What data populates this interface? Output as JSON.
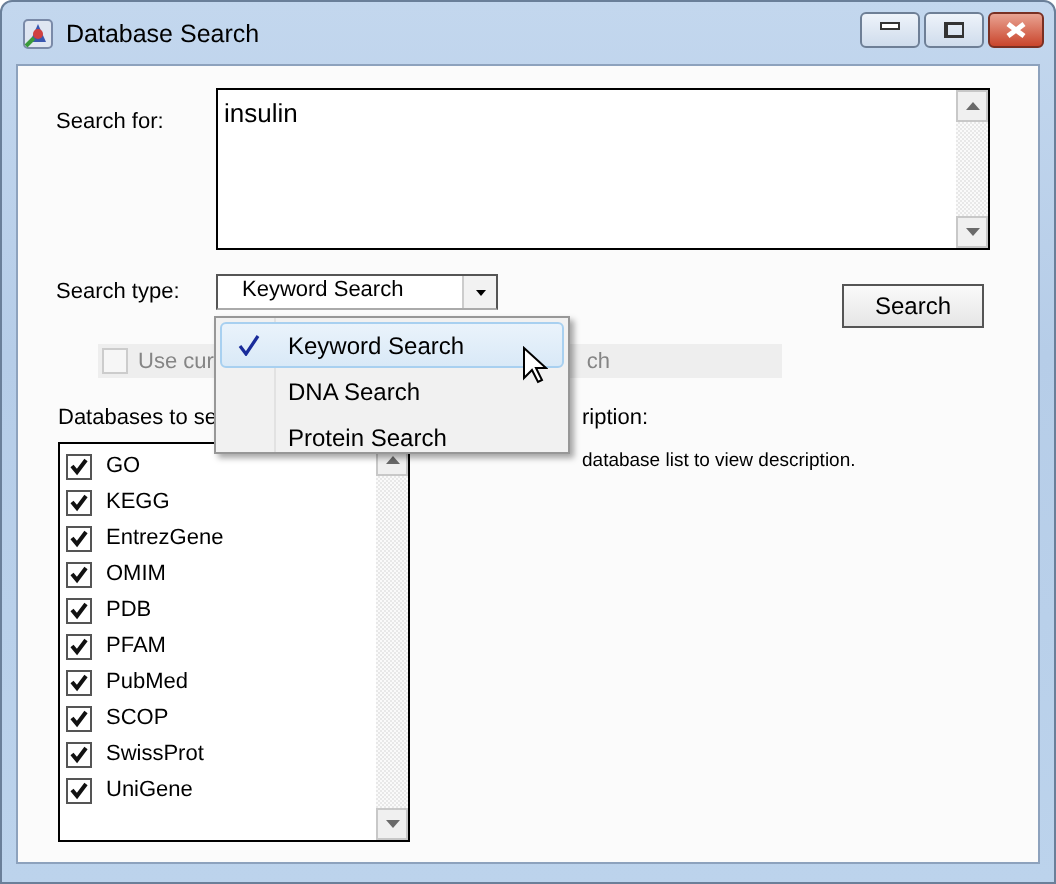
{
  "window": {
    "title": "Database Search"
  },
  "search_for": {
    "label": "Search for:",
    "value": "insulin"
  },
  "search_type": {
    "label": "Search type:",
    "value": "Keyword Search"
  },
  "search_button": {
    "label": "Search"
  },
  "use_current": {
    "label_start": "Use cur",
    "label_end": "ch",
    "checked": false,
    "disabled": true
  },
  "databases": {
    "label": "Databases to se",
    "items": [
      {
        "label": "GO",
        "checked": true
      },
      {
        "label": "KEGG",
        "checked": true
      },
      {
        "label": "EntrezGene",
        "checked": true
      },
      {
        "label": "OMIM",
        "checked": true
      },
      {
        "label": "PDB",
        "checked": true
      },
      {
        "label": "PFAM",
        "checked": true
      },
      {
        "label": "PubMed",
        "checked": true
      },
      {
        "label": "SCOP",
        "checked": true
      },
      {
        "label": "SwissProt",
        "checked": true
      },
      {
        "label": "UniGene",
        "checked": true
      }
    ]
  },
  "description": {
    "label": "ription:",
    "text": "database list to view description."
  },
  "dropdown_menu": {
    "items": [
      {
        "label": "Keyword Search",
        "selected": true
      },
      {
        "label": "DNA Search",
        "selected": false
      },
      {
        "label": "Protein Search",
        "selected": false
      }
    ]
  }
}
